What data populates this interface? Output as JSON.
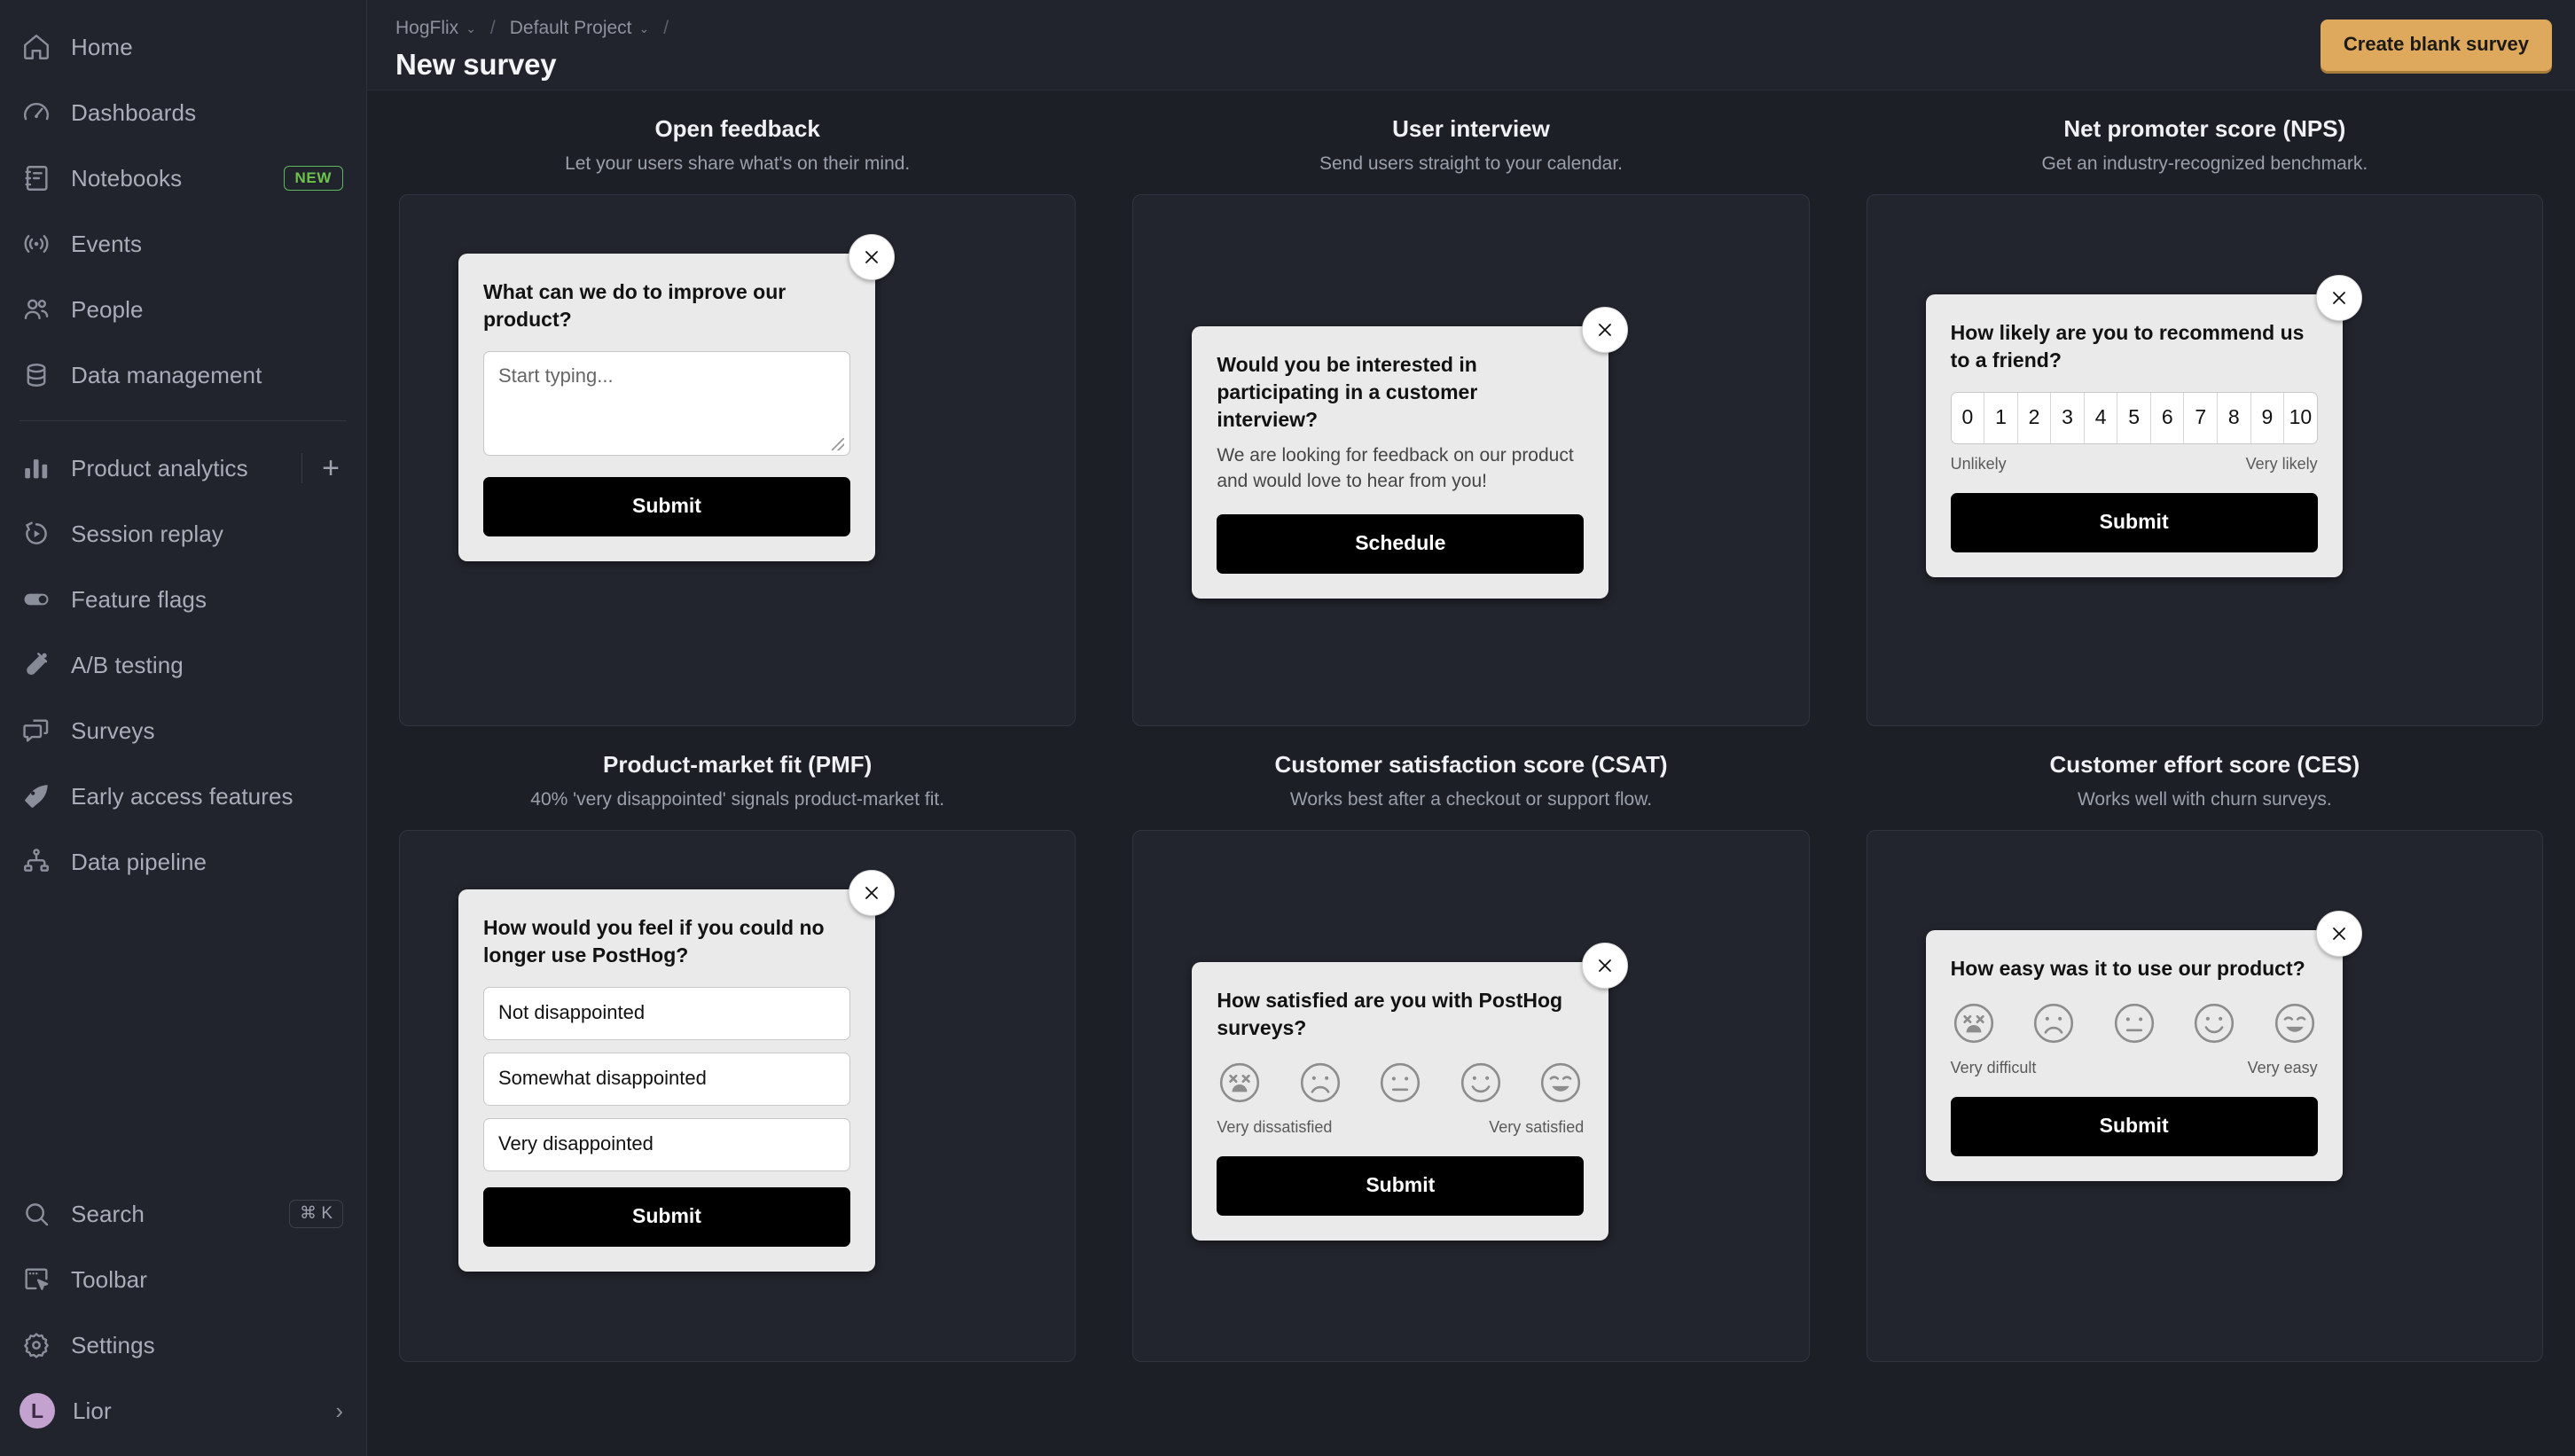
{
  "sidebar": {
    "top_items": [
      {
        "label": "Home",
        "icon": "home-icon"
      },
      {
        "label": "Dashboards",
        "icon": "gauge-icon"
      },
      {
        "label": "Notebooks",
        "icon": "notebook-icon",
        "badge": "NEW"
      },
      {
        "label": "Events",
        "icon": "broadcast-icon"
      },
      {
        "label": "People",
        "icon": "people-icon"
      },
      {
        "label": "Data management",
        "icon": "database-icon"
      }
    ],
    "product_items": [
      {
        "label": "Product analytics",
        "icon": "bar-chart-icon",
        "action": "+"
      },
      {
        "label": "Session replay",
        "icon": "replay-icon"
      },
      {
        "label": "Feature flags",
        "icon": "toggle-icon"
      },
      {
        "label": "A/B testing",
        "icon": "flask-icon"
      },
      {
        "label": "Surveys",
        "icon": "chat-bubbles-icon"
      },
      {
        "label": "Early access features",
        "icon": "rocket-icon"
      },
      {
        "label": "Data pipeline",
        "icon": "pipeline-icon"
      }
    ],
    "bottom_items": [
      {
        "label": "Search",
        "icon": "search-icon",
        "shortcut": "⌘ K"
      },
      {
        "label": "Toolbar",
        "icon": "toolbar-icon"
      },
      {
        "label": "Settings",
        "icon": "gear-icon"
      }
    ],
    "account": {
      "name": "Lior",
      "initial": "L",
      "chevron": "›"
    }
  },
  "topbar": {
    "breadcrumbs": [
      {
        "label": "HogFlix",
        "caret": "⌄"
      },
      {
        "label": "Default Project",
        "caret": "⌄"
      }
    ],
    "separator": "/",
    "page_title": "New survey",
    "create_button": "Create blank survey",
    "accent_color": "#dfa95d"
  },
  "templates": [
    {
      "title": "Open feedback",
      "subtitle": "Let your users share what's on their mind.",
      "type": "open-text",
      "question": "What can we do to improve our product?",
      "input_placeholder": "Start typing...",
      "submit_label": "Submit",
      "close_icon": "close-icon"
    },
    {
      "title": "User interview",
      "subtitle": "Send users straight to your calendar.",
      "type": "link",
      "question": "Would you be interested in participating in a customer interview?",
      "description": "We are looking for feedback on our product and would love to hear from you!",
      "submit_label": "Schedule",
      "close_icon": "close-icon"
    },
    {
      "title": "Net promoter score (NPS)",
      "subtitle": "Get an industry-recognized benchmark.",
      "type": "rating-number",
      "question": "How likely are you to recommend us to a friend?",
      "scale": [
        "0",
        "1",
        "2",
        "3",
        "4",
        "5",
        "6",
        "7",
        "8",
        "9",
        "10"
      ],
      "lower_label": "Unlikely",
      "upper_label": "Very likely",
      "submit_label": "Submit",
      "close_icon": "close-icon"
    },
    {
      "title": "Product-market fit (PMF)",
      "subtitle": "40% 'very disappointed' signals product-market fit.",
      "type": "single-choice",
      "question": "How would you feel if you could no longer use PostHog?",
      "choices": [
        "Not disappointed",
        "Somewhat disappointed",
        "Very disappointed"
      ],
      "submit_label": "Submit",
      "close_icon": "close-icon"
    },
    {
      "title": "Customer satisfaction score (CSAT)",
      "subtitle": "Works best after a checkout or support flow.",
      "type": "rating-emoji",
      "question": "How satisfied are you with PostHog surveys?",
      "emojis": [
        "dead-face-icon",
        "sad-face-icon",
        "neutral-face-icon",
        "smile-face-icon",
        "very-happy-face-icon"
      ],
      "lower_label": "Very dissatisfied",
      "upper_label": "Very satisfied",
      "submit_label": "Submit",
      "close_icon": "close-icon"
    },
    {
      "title": "Customer effort score (CES)",
      "subtitle": "Works well with churn surveys.",
      "type": "rating-emoji",
      "question": "How easy was it to use our product?",
      "emojis": [
        "dead-face-icon",
        "sad-face-icon",
        "neutral-face-icon",
        "smile-face-icon",
        "very-happy-face-icon"
      ],
      "lower_label": "Very difficult",
      "upper_label": "Very easy",
      "submit_label": "Submit",
      "close_icon": "close-icon"
    }
  ]
}
